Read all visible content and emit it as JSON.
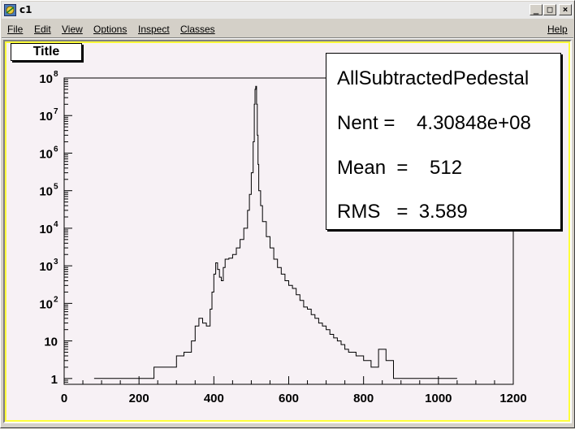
{
  "window": {
    "title": "c1",
    "controls": {
      "minimize": "_",
      "maximize": "□",
      "close": "×"
    }
  },
  "menu": {
    "file": "File",
    "edit": "Edit",
    "view": "View",
    "options": "Options",
    "inspect": "Inspect",
    "classes": "Classes",
    "help": "Help"
  },
  "plot": {
    "title_label": "Title",
    "stats": {
      "name": "AllSubtractedPedestal",
      "nent": "Nent =    4.30848e+08",
      "mean": "Mean  =    512",
      "rms": "RMS   =  3.589"
    }
  },
  "colors": {
    "canvas_background": "#f7f1f5",
    "highlight_border": "#ffff3a",
    "histogram_line": "#000000"
  },
  "chart_data": {
    "type": "line",
    "title": "Title",
    "xlabel": "",
    "ylabel": "",
    "xlim": [
      0,
      1200
    ],
    "ylim": [
      0.7,
      100000000
    ],
    "y_scale": "log",
    "x_ticks": [
      "0",
      "200",
      "400",
      "600",
      "800",
      "1000",
      "1200"
    ],
    "y_ticks": [
      {
        "base": "1",
        "exp": ""
      },
      {
        "base": "10",
        "exp": ""
      },
      {
        "base": "10",
        "exp": "2"
      },
      {
        "base": "10",
        "exp": "3"
      },
      {
        "base": "10",
        "exp": "4"
      },
      {
        "base": "10",
        "exp": "5"
      },
      {
        "base": "10",
        "exp": "6"
      },
      {
        "base": "10",
        "exp": "7"
      },
      {
        "base": "10",
        "exp": "8"
      }
    ],
    "series": [
      {
        "x": [
          80,
          150,
          200,
          240,
          280,
          300,
          320,
          340,
          350,
          360,
          370,
          380,
          390,
          395,
          400,
          405,
          410,
          415,
          420,
          425,
          430,
          440,
          450,
          460,
          470,
          480,
          490,
          495,
          500,
          505,
          508,
          510,
          512,
          514,
          516,
          518,
          520,
          525,
          530,
          540,
          550,
          560,
          570,
          580,
          590,
          600,
          610,
          620,
          630,
          640,
          650,
          660,
          670,
          680,
          690,
          700,
          710,
          720,
          730,
          740,
          750,
          760,
          780,
          800,
          820,
          840,
          860,
          880,
          900,
          950,
          1000,
          1050
        ],
        "y": [
          1,
          1,
          1,
          2,
          2,
          4,
          5,
          10,
          25,
          40,
          30,
          25,
          70,
          200,
          600,
          1200,
          800,
          500,
          400,
          900,
          1500,
          1600,
          2000,
          3000,
          5000,
          10000,
          30000,
          80000,
          300000,
          2000000,
          20000000,
          50000000,
          60000000,
          20000000,
          3000000,
          500000,
          100000,
          40000,
          15000,
          6000,
          3000,
          1500,
          900,
          600,
          400,
          300,
          250,
          170,
          120,
          80,
          70,
          50,
          40,
          30,
          25,
          20,
          15,
          12,
          10,
          8,
          6,
          5,
          4,
          3,
          2,
          6,
          3,
          1,
          1,
          1,
          1,
          1
        ]
      }
    ]
  }
}
